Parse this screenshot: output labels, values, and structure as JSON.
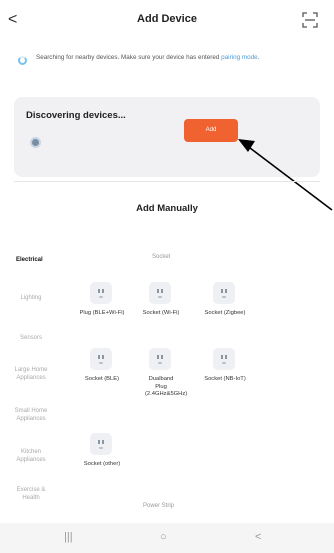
{
  "header": {
    "title": "Add Device",
    "back_glyph": "<",
    "scan_icon": "scan-icon"
  },
  "search": {
    "text": "Searching for nearby devices. Make sure your device has entered ",
    "link": "pairing mode",
    "suffix": "."
  },
  "discover": {
    "title": "Discovering devices...",
    "add_label": "Add"
  },
  "manual": {
    "title": "Add Manually"
  },
  "categories": [
    "Electrical",
    "Lighting",
    "Sensors",
    "Large Home Appliances",
    "Small Home Appliances",
    "Kitchen Appliances",
    "Exercise & Health"
  ],
  "subcategory": {
    "socket": "Socket",
    "power_strip": "Power Strip"
  },
  "devices": [
    {
      "name": "Plug (BLE+Wi-Fi)"
    },
    {
      "name": "Socket (Wi-Fi)"
    },
    {
      "name": "Socket (Zigbee)"
    },
    {
      "name": "Socket (BLE)"
    },
    {
      "name": "Dualband Plug (2.4GHz&5GHz)"
    },
    {
      "name": "Socket (NB-IoT)"
    },
    {
      "name": "Socket (other)"
    }
  ],
  "navbar": {
    "recents": "|||",
    "home": "○",
    "back": "<"
  },
  "colors": {
    "accent": "#f06230",
    "link": "#4a9ad8",
    "card_bg": "#f1f1f3"
  }
}
